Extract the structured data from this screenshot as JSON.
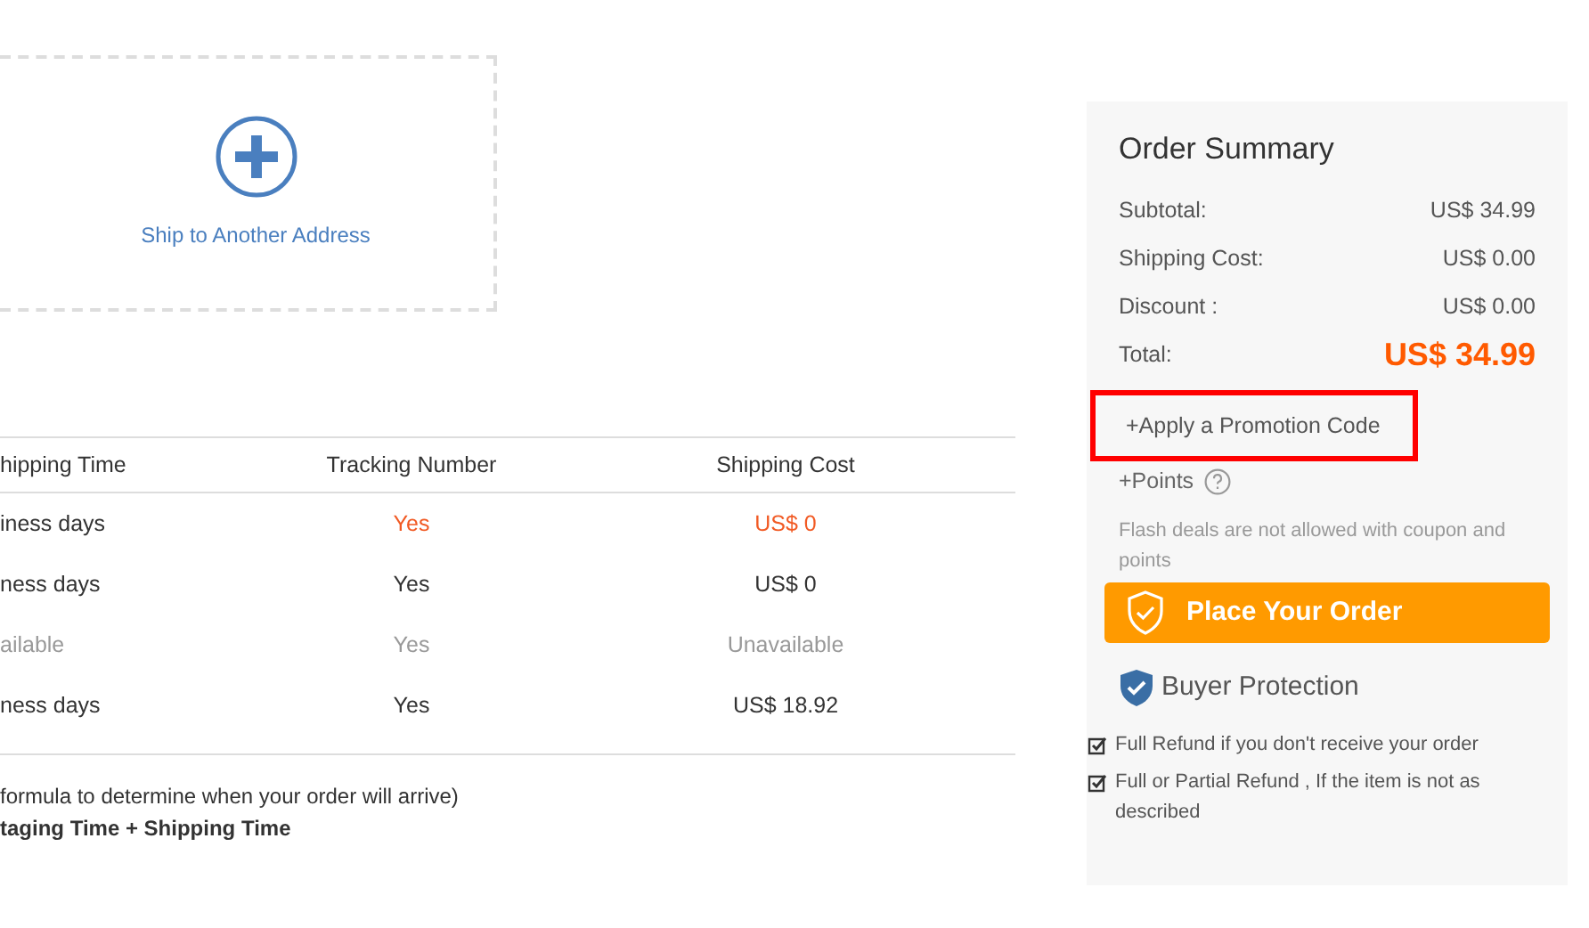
{
  "address_card": {
    "label": "Ship to Another Address"
  },
  "shipping_table": {
    "columns": [
      "hipping Time",
      "Tracking Number",
      "Shipping Cost"
    ],
    "rows": [
      {
        "cells": [
          "iness days",
          "Yes",
          "US$ 0"
        ],
        "selected": true,
        "disabled": false
      },
      {
        "cells": [
          "ness days",
          "Yes",
          "US$ 0"
        ],
        "selected": false,
        "disabled": false
      },
      {
        "cells": [
          "ailable",
          "Yes",
          "Unavailable"
        ],
        "selected": false,
        "disabled": true
      },
      {
        "cells": [
          "ness days",
          "Yes",
          "US$ 18.92"
        ],
        "selected": false,
        "disabled": false
      }
    ]
  },
  "formula_note": "formula to determine when your order will arrive)",
  "formula": "taging Time + Shipping Time",
  "order_summary": {
    "title": "Order Summary",
    "lines": [
      {
        "label": "Subtotal:",
        "value": "US$ 34.99"
      },
      {
        "label": "Shipping Cost:",
        "value": "US$ 0.00"
      },
      {
        "label": "Discount :",
        "value": "US$  0.00"
      }
    ],
    "total": {
      "label": "Total:",
      "value": "US$  34.99"
    },
    "promotion_link": {
      "label": "+Apply a Promotion Code",
      "highlighted": true
    },
    "points_link": "+Points",
    "note": "Flash deals are not allowed with coupon and points",
    "place_order_button": "Place Your Order",
    "buyer_protection": {
      "title": "Buyer Protection",
      "items": [
        {
          "text": "Full Refund if you don't receive your order",
          "checked": true
        },
        {
          "text": "Full or Partial Refund , If the item is not as described",
          "checked": true
        }
      ]
    }
  }
}
